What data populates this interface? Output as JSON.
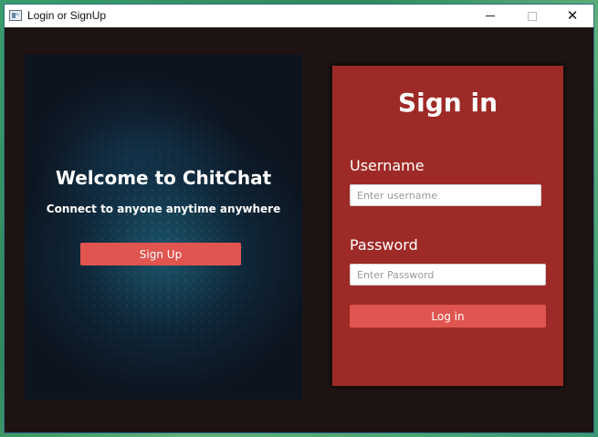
{
  "window": {
    "title": "Login or SignUp",
    "icon": "app-window-icon",
    "controls": {
      "minimize": "minimize-icon",
      "maximize": "maximize-icon",
      "close": "close-icon",
      "close_glyph": "✕"
    }
  },
  "welcome": {
    "title": "Welcome to ChitChat",
    "subtitle": "Connect to anyone anytime anywhere",
    "signup_label": "Sign Up"
  },
  "signin": {
    "title": "Sign in",
    "username_label": "Username",
    "username_placeholder": "Enter username",
    "username_value": "",
    "password_label": "Password",
    "password_placeholder": "Enter Password",
    "password_value": "",
    "login_label": "Log in"
  },
  "colors": {
    "window_bg": "#1e1413",
    "signin_panel": "#9e2a27",
    "button": "#e05550",
    "text": "#ffffff"
  }
}
